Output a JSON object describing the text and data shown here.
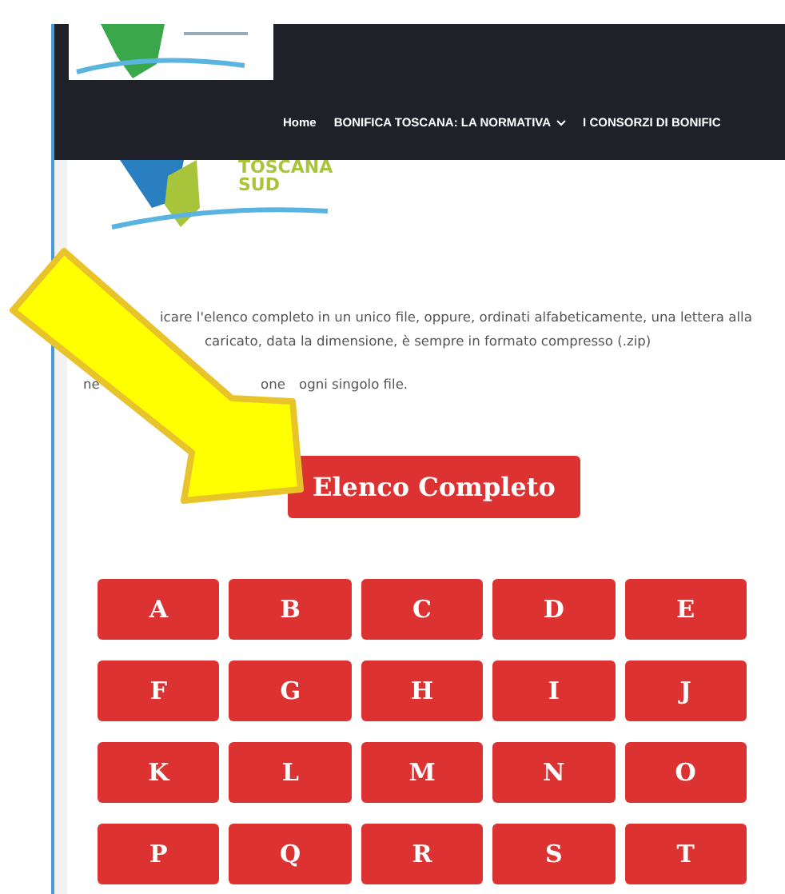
{
  "nav": [
    {
      "label": "Home",
      "dropdown": false
    },
    {
      "label": "BONIFICA TOSCANA: LA NORMATIVA",
      "dropdown": true
    },
    {
      "label": "I CONSORZI DI BONIFIC",
      "dropdown": false
    }
  ],
  "content_logo": {
    "text": "TOSCANA",
    "subtext": "SUD"
  },
  "paragraph_lines": [
    [
      "icare l'elenco completo in un unico file, oppure, ordinati alfabeticamente, una lettera alla"
    ],
    [
      "caricato, data la dimensione, è sempre in formato compresso (.zip)"
    ],
    [
      "ne",
      "one",
      "ogni singolo file."
    ]
  ],
  "full_list_button": "Elenco Completo",
  "letters": [
    "A",
    "B",
    "C",
    "D",
    "E",
    "F",
    "G",
    "H",
    "I",
    "J",
    "K",
    "L",
    "M",
    "N",
    "O",
    "P",
    "Q",
    "R",
    "S",
    "T"
  ]
}
